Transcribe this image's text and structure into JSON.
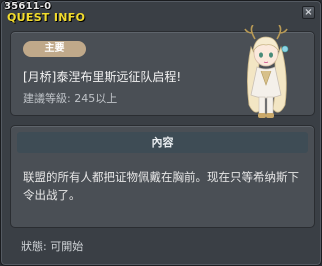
{
  "window": {
    "quest_id": "35611-0",
    "title": "QUEST INFO",
    "close_label": "×"
  },
  "quest": {
    "badge": "主要",
    "name": "[月桥]泰涅布里斯远征队启程!",
    "level_requirement": "建議等級: 245以上"
  },
  "content": {
    "header": "內容",
    "description": "联盟的所有人都把证物佩戴在胸前。现在只等希纳斯下令出战了。"
  },
  "status": {
    "text": "狀態: 可開始"
  },
  "colors": {
    "title": "#f2dc2e",
    "badge": "#c0a98a",
    "panel": "#4a4f55",
    "header": "#3e4c55"
  },
  "icons": {
    "npc": "npc-portrait-icon",
    "close": "close-icon"
  }
}
